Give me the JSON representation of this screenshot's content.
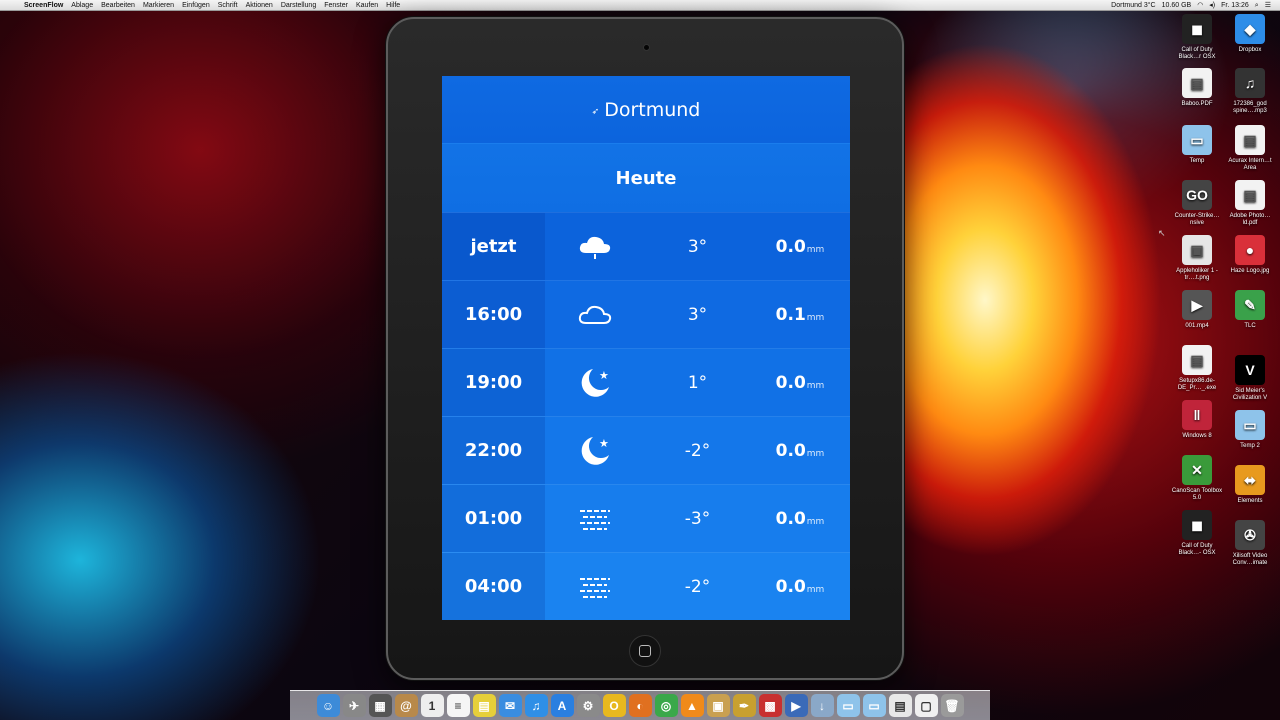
{
  "menubar": {
    "apple_glyph": "",
    "app_name": "ScreenFlow",
    "menus": [
      "Ablage",
      "Bearbeiten",
      "Markieren",
      "Einfügen",
      "Schrift",
      "Aktionen",
      "Darstellung",
      "Fenster",
      "Kaufen",
      "Hilfe"
    ],
    "status": {
      "weather": "Dortmund 3°C",
      "disk": "10.60 GB",
      "clock": "Fr. 13:26"
    }
  },
  "weather_app": {
    "city": "Dortmund",
    "city_arrow": "➶",
    "day": "Heute",
    "precip_unit": "mm",
    "rows": [
      {
        "time": "jetzt",
        "icon": "cloud-rain-icon",
        "glyph": "☁",
        "temp": "3°",
        "precip": "0.0"
      },
      {
        "time": "16:00",
        "icon": "cloud-icon",
        "glyph": "☁",
        "temp": "3°",
        "precip": "0.1"
      },
      {
        "time": "19:00",
        "icon": "moon-star-icon",
        "glyph": "☾",
        "temp": "1°",
        "precip": "0.0"
      },
      {
        "time": "22:00",
        "icon": "moon-star-icon",
        "glyph": "☾",
        "temp": "-2°",
        "precip": "0.0"
      },
      {
        "time": "01:00",
        "icon": "fog-icon",
        "glyph": "≋",
        "temp": "-3°",
        "precip": "0.0"
      },
      {
        "time": "04:00",
        "icon": "fog-icon",
        "glyph": "≋",
        "temp": "-2°",
        "precip": "0.0"
      }
    ]
  },
  "desktop_icons": [
    {
      "label": "Call of Duty Black…r OSX",
      "icon": "game-icon",
      "glyph": "◼",
      "color": "#222222"
    },
    {
      "label": "Dropbox",
      "icon": "dropbox-icon",
      "glyph": "◆",
      "color": "#2d8de8"
    },
    {
      "label": "Baboo.PDF",
      "icon": "pdf-icon",
      "glyph": "▤",
      "color": "#f2f2f2"
    },
    {
      "label": "172386_god spine….mp3",
      "icon": "music-file-icon",
      "glyph": "♫",
      "color": "#333333"
    },
    {
      "label": "Temp",
      "icon": "folder-icon",
      "glyph": "▭",
      "color": "#8ec3ea"
    },
    {
      "label": "Acurax Intern…t Area",
      "icon": "pdf-icon",
      "glyph": "▤",
      "color": "#f2f2f2"
    },
    {
      "label": "Counter-Strike…nsive",
      "icon": "game-icon",
      "glyph": "GO",
      "color": "#444444"
    },
    {
      "label": "Adobe Photo…ld.pdf",
      "icon": "pdf-icon",
      "glyph": "▤",
      "color": "#f2f2f2"
    },
    {
      "label": "Appleholiker 1 - tr….t.png",
      "icon": "image-icon",
      "glyph": "▣",
      "color": "#e6e6e6"
    },
    {
      "label": "Haze Logo.jpg",
      "icon": "image-icon",
      "glyph": "●",
      "color": "#d9303a"
    },
    {
      "label": "001.mp4",
      "icon": "video-icon",
      "glyph": "▶",
      "color": "#555555"
    },
    {
      "label": "TLC",
      "icon": "logo-icon",
      "glyph": "✎",
      "color": "#3aa14a"
    },
    {
      "label": "Setupx86.de-DE_Pr…_.exe",
      "icon": "file-icon",
      "glyph": "▤",
      "color": "#f2f2f2"
    },
    {
      "label": "Sid Meier's Civilization V",
      "icon": "game-icon",
      "glyph": "V",
      "color": "#000000"
    },
    {
      "label": "Windows 8",
      "icon": "parallels-icon",
      "glyph": "‖",
      "color": "#c0243a"
    },
    {
      "label": "Temp 2",
      "icon": "folder-icon",
      "glyph": "▭",
      "color": "#8ec3ea"
    },
    {
      "label": "CanoScan Toolbox 5.0",
      "icon": "scanner-icon",
      "glyph": "✕",
      "color": "#3a9a3a"
    },
    {
      "label": "Elements",
      "icon": "usb-drive-icon",
      "glyph": "⬌",
      "color": "#e89a1e"
    },
    {
      "label": "Call of Duty Black…- OSX",
      "icon": "game-icon",
      "glyph": "◼",
      "color": "#222222"
    },
    {
      "label": "Xilisoft Video Conv…imate",
      "icon": "film-reel-icon",
      "glyph": "✇",
      "color": "#444444"
    }
  ],
  "dock_items": [
    {
      "name": "finder-icon",
      "glyph": "☺",
      "color": "#3d8bd8"
    },
    {
      "name": "launchpad-icon",
      "glyph": "✈",
      "color": "#888888"
    },
    {
      "name": "mission-control-icon",
      "glyph": "▦",
      "color": "#555555"
    },
    {
      "name": "contacts-icon",
      "glyph": "@",
      "color": "#b8894a"
    },
    {
      "name": "calendar-icon",
      "glyph": "1",
      "color": "#eeeeee"
    },
    {
      "name": "notes-icon",
      "glyph": "≡",
      "color": "#f5f5f5"
    },
    {
      "name": "stickies-icon",
      "glyph": "▤",
      "color": "#e6cf3a"
    },
    {
      "name": "messages-icon",
      "glyph": "✉",
      "color": "#3a8de0"
    },
    {
      "name": "itunes-icon",
      "glyph": "♫",
      "color": "#2f8fe6"
    },
    {
      "name": "app-store-icon",
      "glyph": "A",
      "color": "#2a7fe0"
    },
    {
      "name": "system-preferences-icon",
      "glyph": "⚙",
      "color": "#8a8a8a"
    },
    {
      "name": "opera-icon",
      "glyph": "O",
      "color": "#e8b81e"
    },
    {
      "name": "firefox-icon",
      "glyph": "◐",
      "color": "#e07020"
    },
    {
      "name": "chrome-icon",
      "glyph": "◎",
      "color": "#3aa84a"
    },
    {
      "name": "vlc-icon",
      "glyph": "▲",
      "color": "#f08a1a"
    },
    {
      "name": "archive-icon",
      "glyph": "▣",
      "color": "#c9a050"
    },
    {
      "name": "quill-icon",
      "glyph": "✒",
      "color": "#c8a030"
    },
    {
      "name": "photo-booth-icon",
      "glyph": "▩",
      "color": "#c83030"
    },
    {
      "name": "screenflow-icon",
      "glyph": "▶",
      "color": "#3a6ab8"
    },
    {
      "name": "downloads-icon",
      "glyph": "↓",
      "color": "#8aa8c8"
    },
    {
      "name": "folder-icon",
      "glyph": "▭",
      "color": "#8ec3ea"
    },
    {
      "name": "folder-icon",
      "glyph": "▭",
      "color": "#8ec3ea"
    },
    {
      "name": "documents-icon",
      "glyph": "▤",
      "color": "#e8e8e8"
    },
    {
      "name": "preview-icon",
      "glyph": "▢",
      "color": "#f0f0f0"
    },
    {
      "name": "trash-icon",
      "glyph": "🗑",
      "color": "#9a9a9a"
    }
  ]
}
